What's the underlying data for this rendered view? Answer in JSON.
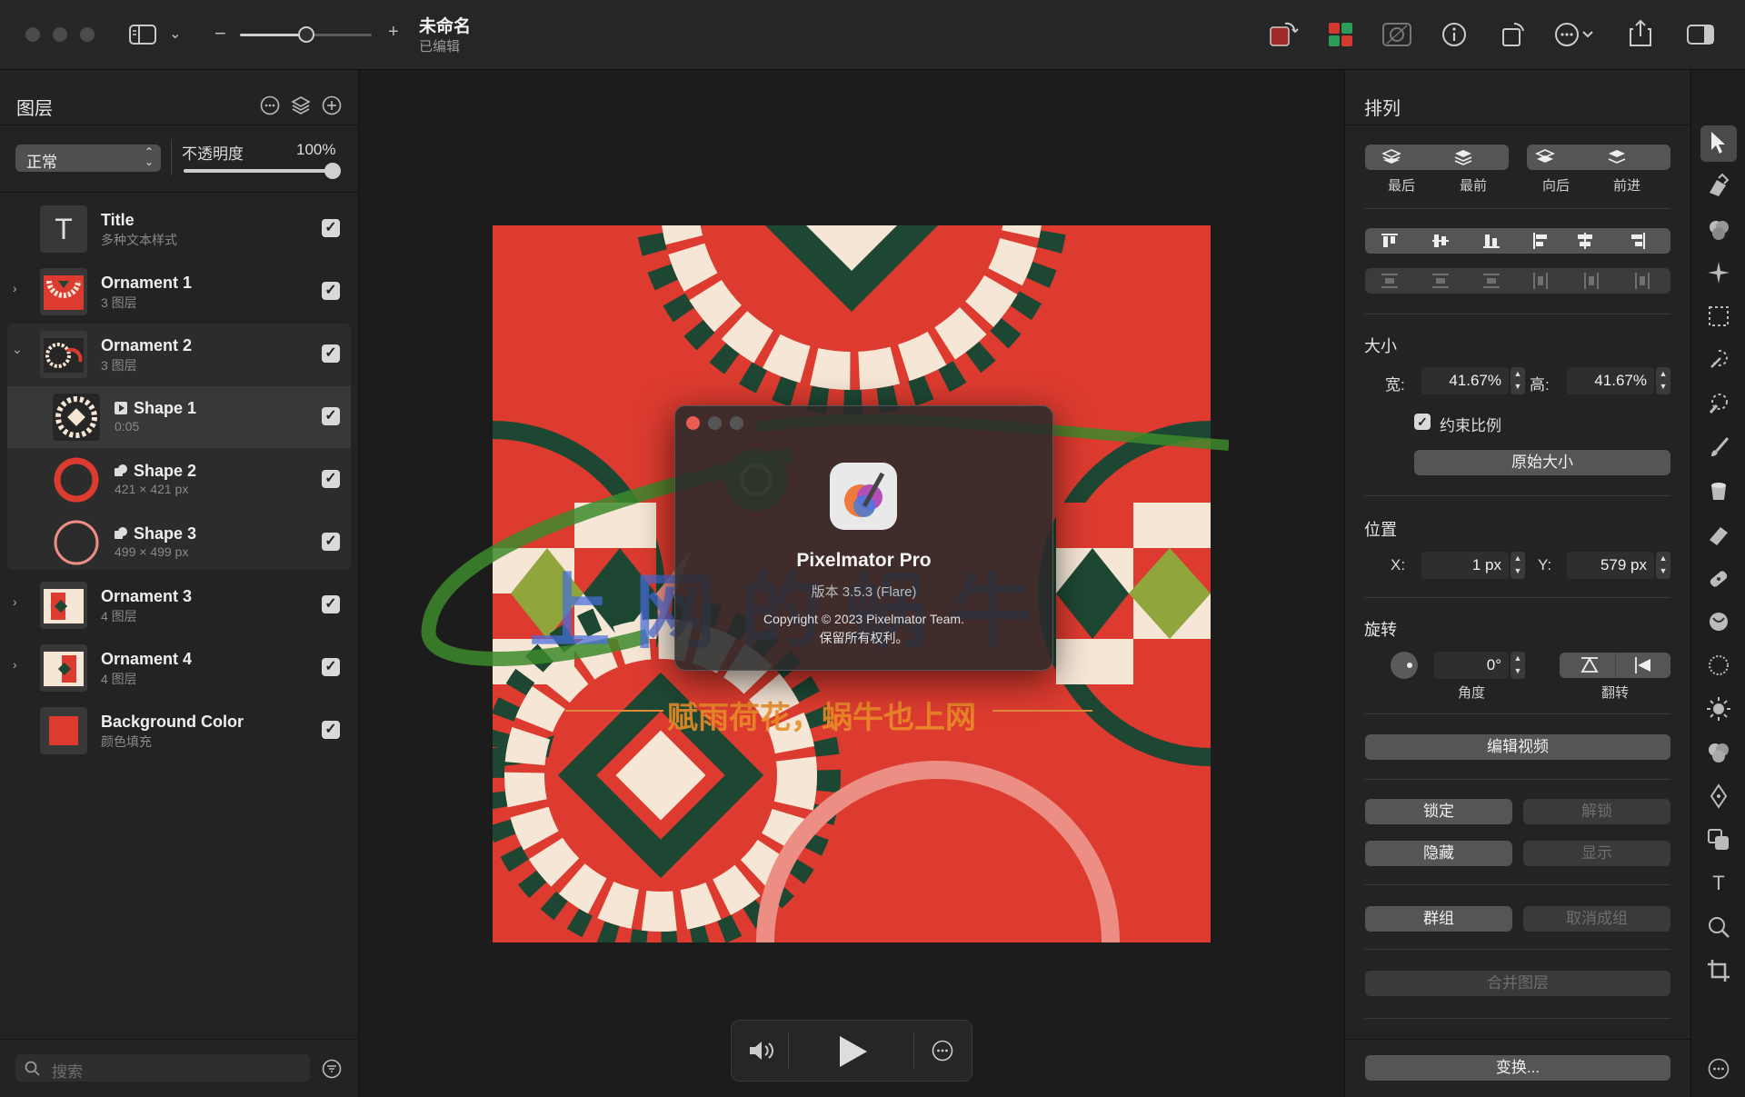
{
  "window": {
    "title": "未命名",
    "subtitle": "已编辑"
  },
  "toolbar": {
    "zoom_minus": "−",
    "zoom_plus": "+"
  },
  "layers_panel": {
    "title": "图层",
    "blend_mode": "正常",
    "opacity_label": "不透明度",
    "opacity_value": "100%",
    "opacity_fraction": 1.0,
    "search_placeholder": "搜索",
    "layers": [
      {
        "name": "Title",
        "sub": "多种文本样式",
        "checked": "✓"
      },
      {
        "name": "Ornament 1",
        "sub": "3 图层",
        "checked": "✓"
      },
      {
        "name": "Ornament 2",
        "sub": "3 图层",
        "checked": "✓"
      },
      {
        "name": "Shape 1",
        "sub": "0:05",
        "checked": "✓"
      },
      {
        "name": "Shape 2",
        "sub": "421 × 421 px",
        "checked": "✓"
      },
      {
        "name": "Shape 3",
        "sub": "499 × 499 px",
        "checked": "✓"
      },
      {
        "name": "Ornament 3",
        "sub": "4 图层",
        "checked": "✓"
      },
      {
        "name": "Ornament 4",
        "sub": "4 图层",
        "checked": "✓"
      },
      {
        "name": "Background Color",
        "sub": "颜色填充",
        "checked": "✓"
      }
    ]
  },
  "arrange_panel": {
    "title": "排列",
    "order_buttons": [
      "最后",
      "最前",
      "向后",
      "前进"
    ],
    "size_section": "大小",
    "width_label": "宽:",
    "width_value": "41.67%",
    "height_label": "高:",
    "height_value": "41.67%",
    "constrain_label": "约束比例",
    "original_size_button": "原始大小",
    "position_section": "位置",
    "x_label": "X:",
    "x_value": "1 px",
    "y_label": "Y:",
    "y_value": "579 px",
    "rotate_section": "旋转",
    "angle_value": "0°",
    "angle_label": "角度",
    "flip_label": "翻转",
    "edit_video_button": "编辑视频",
    "lock_button": "锁定",
    "unlock_button": "解锁",
    "hide_button": "隐藏",
    "show_button": "显示",
    "group_button": "群组",
    "ungroup_button": "取消成组",
    "merge_button": "合并图层",
    "transform_button": "变换..."
  },
  "about_dialog": {
    "app_name": "Pixelmator Pro",
    "version": "版本 3.5.3 (Flare)",
    "copyright": "Copyright © 2023 Pixelmator Team.",
    "rights": "保留所有权利。"
  },
  "watermark": {
    "main": "上网的蜗牛",
    "tagline": "赋雨荷花，蜗牛也上网"
  },
  "colors": {
    "canvas_red": "#dd3b2f",
    "dark_green": "#1d4733",
    "cream": "#f6e6d6",
    "pink": "#ec8e84",
    "olive": "#90a63c"
  }
}
